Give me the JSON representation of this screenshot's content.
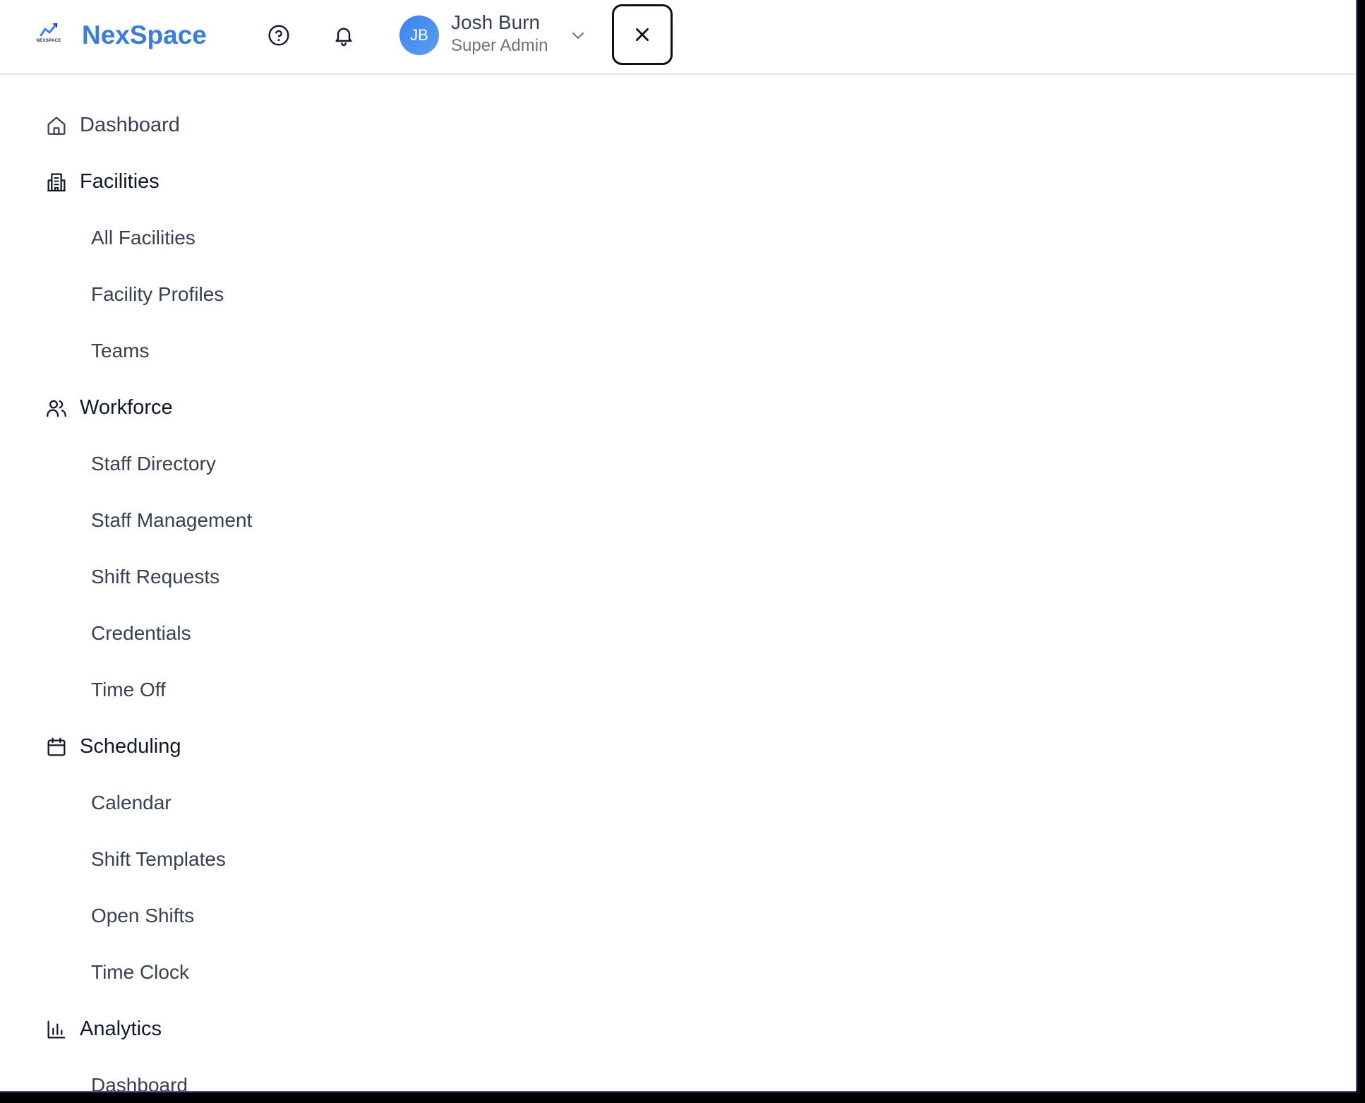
{
  "brand": {
    "name": "NexSpace",
    "logo_text": "NEXSPACE",
    "primary_color": "#3b7dd8"
  },
  "header": {
    "help_icon": "question-circle-icon",
    "notifications_icon": "bell-icon",
    "user": {
      "initials": "JB",
      "name": "Josh Burn",
      "role": "Super Admin"
    },
    "close_icon": "close-icon"
  },
  "nav": {
    "sections": [
      {
        "label": "Dashboard",
        "icon": "home-icon",
        "items": []
      },
      {
        "label": "Facilities",
        "icon": "building-icon",
        "items": [
          "All Facilities",
          "Facility Profiles",
          "Teams"
        ]
      },
      {
        "label": "Workforce",
        "icon": "users-icon",
        "items": [
          "Staff Directory",
          "Staff Management",
          "Shift Requests",
          "Credentials",
          "Time Off"
        ]
      },
      {
        "label": "Scheduling",
        "icon": "calendar-icon",
        "items": [
          "Calendar",
          "Shift Templates",
          "Open Shifts",
          "Time Clock"
        ]
      },
      {
        "label": "Analytics",
        "icon": "bar-chart-icon",
        "items": [
          "Dashboard"
        ]
      }
    ]
  }
}
